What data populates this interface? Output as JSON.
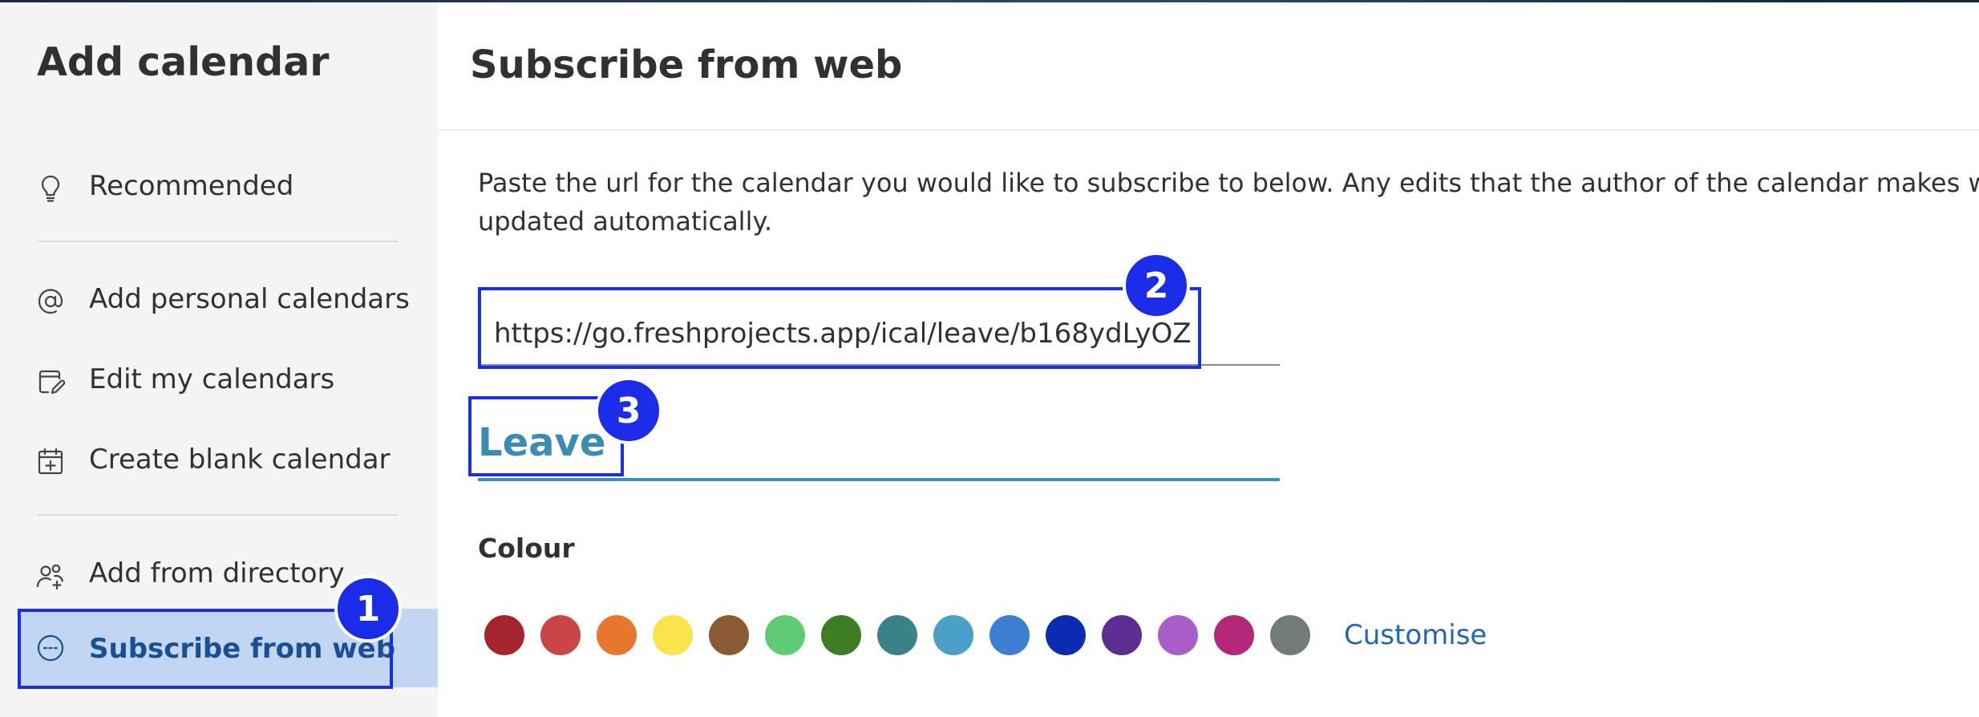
{
  "sidebar": {
    "title": "Add calendar",
    "items": [
      {
        "label": "Recommended",
        "icon": "lightbulb-icon"
      },
      {
        "label": "Add personal calendars",
        "icon": "at-sign-icon"
      },
      {
        "label": "Edit my calendars",
        "icon": "edit-calendar-icon"
      },
      {
        "label": "Create blank calendar",
        "icon": "calendar-add-icon"
      },
      {
        "label": "Add from directory",
        "icon": "people-add-icon"
      },
      {
        "label": "Subscribe from web",
        "icon": "web-link-icon",
        "selected": true
      }
    ]
  },
  "main": {
    "title": "Subscribe from web",
    "instructions_line1": "Paste the url for the calendar you would like to subscribe to below. Any edits that the author of the calendar makes will be",
    "instructions_line2": "updated automatically.",
    "url_value": "https://go.freshprojects.app/ical/leave/b168ydLyOZ",
    "name_value": "Leave",
    "colour_label": "Colour",
    "customise_label": "Customise",
    "colours": [
      "#a4262c",
      "#ca4545",
      "#e8772e",
      "#fbe34a",
      "#8a5a32",
      "#5fcb74",
      "#3c7d23",
      "#3b8287",
      "#4aa0c8",
      "#3a7fd2",
      "#0b2bb0",
      "#5c2e91",
      "#a95fc7",
      "#b4267a",
      "#707b7a"
    ]
  },
  "callouts": {
    "one": "1",
    "two": "2",
    "three": "3"
  },
  "colors": {
    "sidebar_bg": "#f4f4f4",
    "selected_bg": "#c0d6f3",
    "callout_blue": "#1c2fe0",
    "accent_teal": "#3a8cb2",
    "link_blue": "#2266b8"
  }
}
